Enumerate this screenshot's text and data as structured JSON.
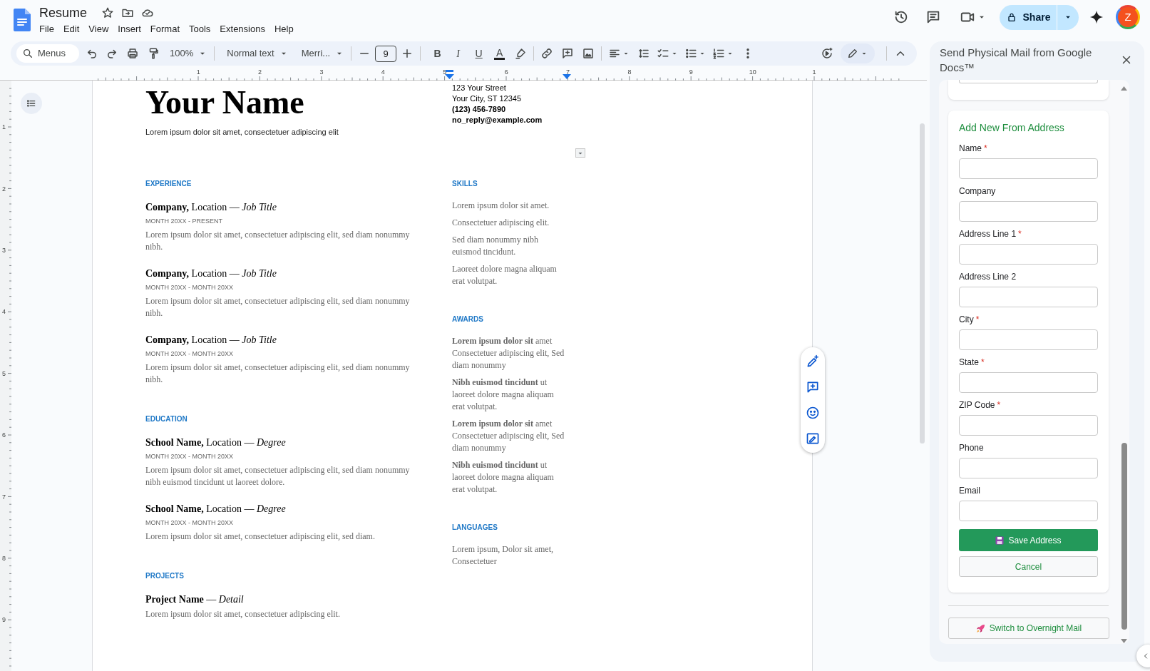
{
  "app": {
    "doc_title": "Resume",
    "starred": false,
    "menu": [
      "File",
      "Edit",
      "View",
      "Insert",
      "Format",
      "Tools",
      "Extensions",
      "Help"
    ],
    "share_label": "Share",
    "avatar_letter": "Z"
  },
  "toolbar": {
    "search_placeholder": "Menus",
    "zoom": "100%",
    "paragraph_style": "Normal text",
    "font": "Merri...",
    "font_size": "9",
    "format_buttons": [
      {
        "kind": "bold",
        "label": "B"
      },
      {
        "kind": "italic",
        "label": "I"
      },
      {
        "kind": "underline",
        "label": "U"
      },
      {
        "kind": "text_color",
        "label": "A"
      }
    ]
  },
  "ruler": {
    "horizontal": [
      "1",
      "2",
      "3",
      "4",
      "5",
      "6",
      "7",
      "8",
      "9",
      "10",
      "1"
    ],
    "vertical": [
      "1",
      "2",
      "3",
      "4",
      "5",
      "6",
      "7",
      "8",
      "9"
    ]
  },
  "document": {
    "header": {
      "name": "Your Name",
      "tagline": "Lorem ipsum dolor sit amet, consectetuer adipiscing elit",
      "contact": [
        {
          "text": "123 Your Street",
          "bold": false
        },
        {
          "text": "Your City, ST 12345",
          "bold": false
        },
        {
          "text": "(123) 456-7890",
          "bold": true
        },
        {
          "text": "no_reply@example.com",
          "bold": true
        }
      ]
    },
    "left_sections": [
      {
        "heading": "EXPERIENCE",
        "entries": [
          {
            "title": "**Company,** Location — *Job Title*",
            "dates": "MONTH 20XX - PRESENT",
            "description": "Lorem ipsum dolor sit amet, consectetuer adipiscing elit, sed diam nonummy nibh."
          },
          {
            "title": "**Company,** Location — *Job Title*",
            "dates": "MONTH 20XX - MONTH 20XX",
            "description": "Lorem ipsum dolor sit amet, consectetuer adipiscing elit, sed diam nonummy nibh."
          },
          {
            "title": "**Company,** Location — *Job Title*",
            "dates": "MONTH 20XX - MONTH 20XX",
            "description": "Lorem ipsum dolor sit amet, consectetuer adipiscing elit, sed diam nonummy nibh."
          }
        ]
      },
      {
        "heading": "EDUCATION",
        "entries": [
          {
            "title": "**School Name,** Location — *Degree*",
            "dates": "MONTH 20XX - MONTH 20XX",
            "description": "Lorem ipsum dolor sit amet, consectetuer adipiscing elit, sed diam nonummy nibh euismod tincidunt ut laoreet dolore."
          },
          {
            "title": "**School Name,** Location — *Degree*",
            "dates": "MONTH 20XX - MONTH 20XX",
            "description": "Lorem ipsum dolor sit amet, consectetuer adipiscing elit, sed diam."
          }
        ]
      },
      {
        "heading": "PROJECTS",
        "entries": [
          {
            "title": "**Project Name** — *Detail*",
            "description": "Lorem ipsum dolor sit amet, consectetuer adipiscing elit."
          }
        ]
      }
    ],
    "right_sections": [
      {
        "heading": "SKILLS",
        "items": [
          "Lorem ipsum dolor sit amet.",
          "Consectetuer adipiscing elit.",
          "Sed diam nonummy nibh euismod tincidunt.",
          "Laoreet dolore magna aliquam erat volutpat."
        ]
      },
      {
        "heading": "AWARDS",
        "items": [
          "**Lorem ipsum dolor sit** amet Consectetuer adipiscing elit, Sed diam nonummy",
          "**Nibh euismod tincidunt** ut laoreet dolore magna aliquam erat volutpat.",
          "**Lorem ipsum dolor sit** amet Consectetuer adipiscing elit, Sed diam nonummy",
          "**Nibh euismod tincidunt** ut laoreet dolore magna aliquam erat volutpat."
        ]
      },
      {
        "heading": "LANGUAGES",
        "items": [
          "Lorem ipsum, Dolor sit amet, Consectetuer"
        ]
      }
    ]
  },
  "side_panel": {
    "title": "Send Physical Mail from Google Docs™",
    "form_title": "Add New From Address",
    "required_mark": "*",
    "fields": [
      {
        "label": "Name",
        "required": true
      },
      {
        "label": "Company",
        "required": false
      },
      {
        "label": "Address Line 1",
        "required": true
      },
      {
        "label": "Address Line 2",
        "required": false
      },
      {
        "label": "City",
        "required": true
      },
      {
        "label": "State",
        "required": true
      },
      {
        "label": "ZIP Code",
        "required": true
      },
      {
        "label": "Phone",
        "required": false
      },
      {
        "label": "Email",
        "required": false
      }
    ],
    "save_label": "Save Address",
    "cancel_label": "Cancel",
    "switch_label": "Switch to Overnight Mail"
  }
}
